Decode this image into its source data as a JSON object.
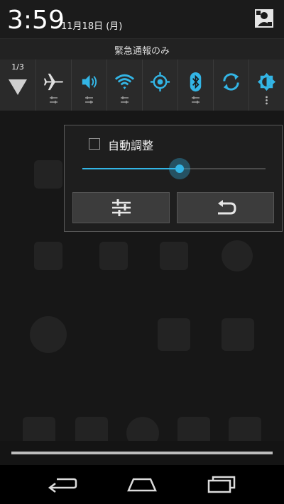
{
  "status": {
    "time": "3:59",
    "date": "11月18日 (月)"
  },
  "emergency": {
    "text": "緊急通報のみ"
  },
  "quick_settings": {
    "page_indicator": "1/3",
    "tiles": [
      {
        "name": "airplane-mode",
        "icon": "airplane-icon"
      },
      {
        "name": "volume",
        "icon": "speaker-icon"
      },
      {
        "name": "wifi",
        "icon": "wifi-icon"
      },
      {
        "name": "location",
        "icon": "gps-icon"
      },
      {
        "name": "bluetooth",
        "icon": "bluetooth-icon"
      },
      {
        "name": "sync",
        "icon": "sync-icon"
      },
      {
        "name": "brightness",
        "icon": "brightness-icon"
      }
    ]
  },
  "brightness_dialog": {
    "auto_label": "自動調整",
    "auto_checked": false,
    "level": 0.53
  },
  "colors": {
    "accent": "#33b5e5",
    "tile_icon": "#33b5e5",
    "background": "#101010"
  }
}
